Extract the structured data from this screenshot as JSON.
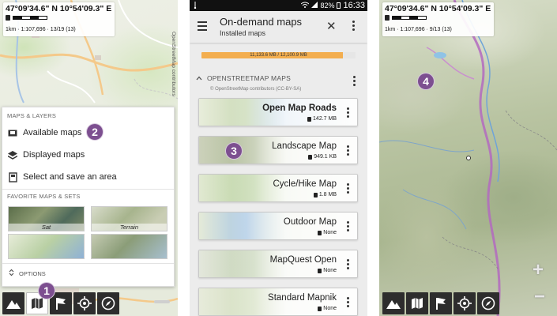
{
  "panel1": {
    "coords": "47°09'34.6\" N 10°54'09.3\" E",
    "scale_text": "1km · 1:107,696 · 13/19 (13)",
    "attribution": "OpenStreetMap contributors",
    "menu": {
      "header": "MAPS & LAYERS",
      "items": [
        {
          "label": "Available maps",
          "icon": "map-folder-icon"
        },
        {
          "label": "Displayed maps",
          "icon": "layers-icon"
        },
        {
          "label": "Select and save an area",
          "icon": "save-area-icon"
        }
      ],
      "favorites_header": "FAVORITE MAPS & SETS",
      "favorites": [
        "Sat",
        "Terrain",
        "",
        ""
      ],
      "options_label": "OPTIONS"
    },
    "badges": [
      "1",
      "2"
    ]
  },
  "panel2": {
    "status": {
      "signal_pct": "82%",
      "time": "16:33"
    },
    "appbar": {
      "title": "On-demand maps",
      "subtitle": "Installed maps"
    },
    "storage": {
      "text": "11,133.6 MB / 12,100.9 MB",
      "used_mb": 11133.6,
      "total_mb": 12100.9
    },
    "section": {
      "title": "OPENSTREETMAP MAPS",
      "subtitle": "© OpenStreetMap contributors (CC-BY-SA)"
    },
    "maps": [
      {
        "name": "Open Map Roads",
        "size": "142.7 MB",
        "bold": true
      },
      {
        "name": "Landscape Map",
        "size": "949.1 KB",
        "bold": false
      },
      {
        "name": "Cycle/Hike Map",
        "size": "1.8 MB",
        "bold": false
      },
      {
        "name": "Outdoor Map",
        "size": "None",
        "bold": false
      },
      {
        "name": "MapQuest Open",
        "size": "None",
        "bold": false
      },
      {
        "name": "Standard Mapnik",
        "size": "None",
        "bold": false
      }
    ],
    "badge": "3"
  },
  "panel3": {
    "coords": "47°09'34.6\" N 10°54'09.3\" E",
    "scale_text": "1km · 1:107,696 · 9/13 (13)",
    "badge": "4",
    "zoom_in": "+",
    "zoom_out": "−"
  },
  "colors": {
    "badge": "#7d4f90",
    "storage_fill": "#f3ae4f",
    "toolbar": "#2d2d2d"
  }
}
